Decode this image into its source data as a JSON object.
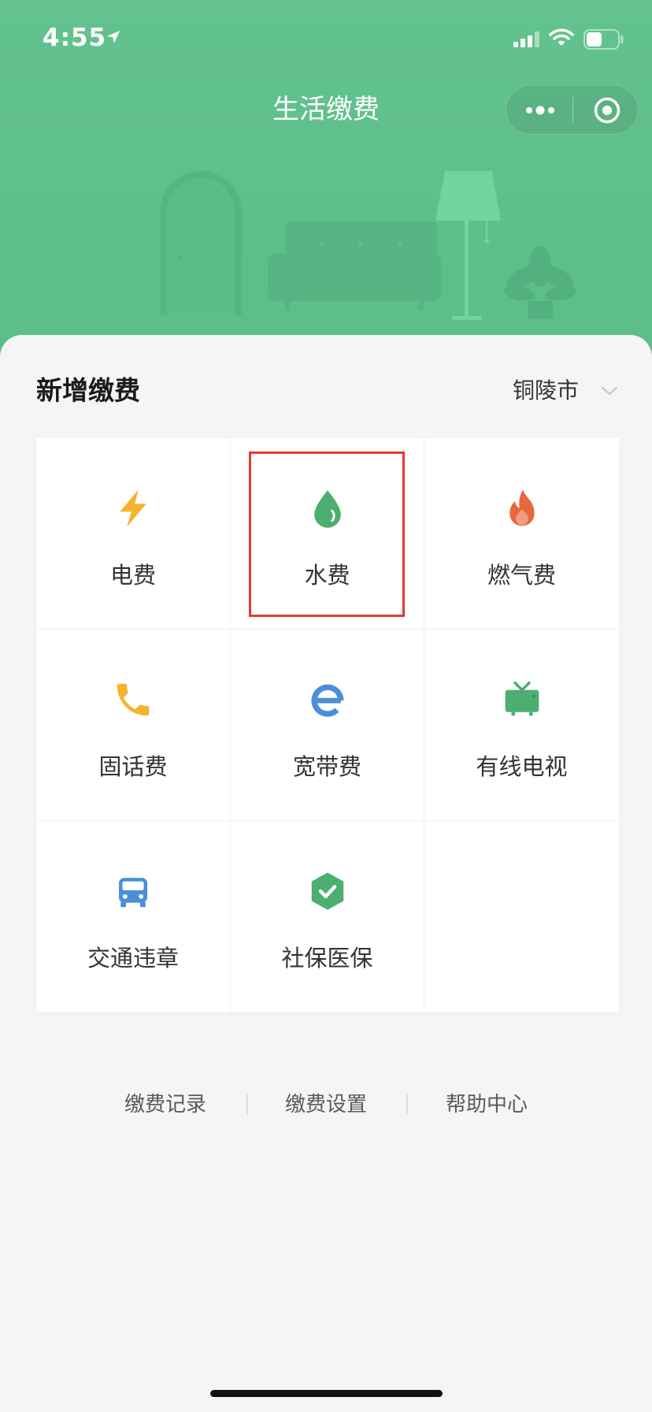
{
  "status_bar": {
    "time": "4:55",
    "battery_level": 0.5,
    "icons": [
      "location-arrow-icon",
      "signal-icon",
      "wifi-icon",
      "battery-icon"
    ]
  },
  "nav": {
    "title": "生活缴费",
    "more_icon": "more-dots-icon",
    "close_icon": "target-icon"
  },
  "section": {
    "title": "新增缴费",
    "city": "铜陵市"
  },
  "services": [
    {
      "label": "电费",
      "icon": "lightning-icon",
      "color": "#F4B42F"
    },
    {
      "label": "水费",
      "icon": "water-drop-icon",
      "color": "#4CAF6F"
    },
    {
      "label": "燃气费",
      "icon": "flame-icon",
      "color": "#E9673F"
    },
    {
      "label": "固话费",
      "icon": "phone-icon",
      "color": "#F4B42F"
    },
    {
      "label": "宽带费",
      "icon": "broadband-e-icon",
      "color": "#4A8FD9"
    },
    {
      "label": "有线电视",
      "icon": "tv-icon",
      "color": "#4CAF6F"
    },
    {
      "label": "交通违章",
      "icon": "car-icon",
      "color": "#4A8FD9"
    },
    {
      "label": "社保医保",
      "icon": "shield-check-icon",
      "color": "#4CAF6F"
    }
  ],
  "footer": {
    "links": [
      "缴费记录",
      "缴费设置",
      "帮助中心"
    ]
  },
  "colors": {
    "header_green": "#5FC08B",
    "highlight_red": "#E23A2E",
    "background": "#F5F5F5"
  }
}
